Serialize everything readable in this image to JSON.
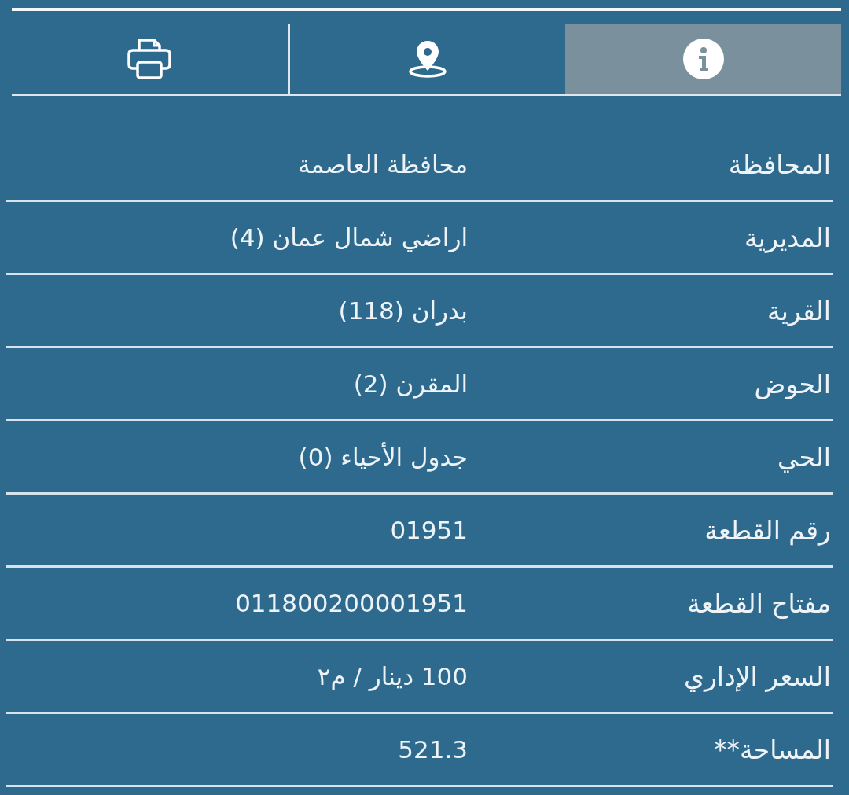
{
  "tabs": [
    {
      "kind": "info",
      "selected": true
    },
    {
      "kind": "location",
      "selected": false
    },
    {
      "kind": "print",
      "selected": false
    }
  ],
  "rows": [
    {
      "label": "المحافظة",
      "value": "محافظة العاصمة"
    },
    {
      "label": "المديرية",
      "value": "اراضي شمال عمان (4)"
    },
    {
      "label": "القرية",
      "value": "بدران (118)"
    },
    {
      "label": "الحوض",
      "value": "المقرن (2)"
    },
    {
      "label": "الحي",
      "value": "جدول الأحياء (0)"
    },
    {
      "label": "رقم القطعة",
      "value": "01951"
    },
    {
      "label": "مفتاح القطعة",
      "value": "011800200001951"
    },
    {
      "label": "السعر الإداري",
      "value": "100 دينار / م٢"
    },
    {
      "label": "المساحة**",
      "value": "521.3"
    }
  ]
}
